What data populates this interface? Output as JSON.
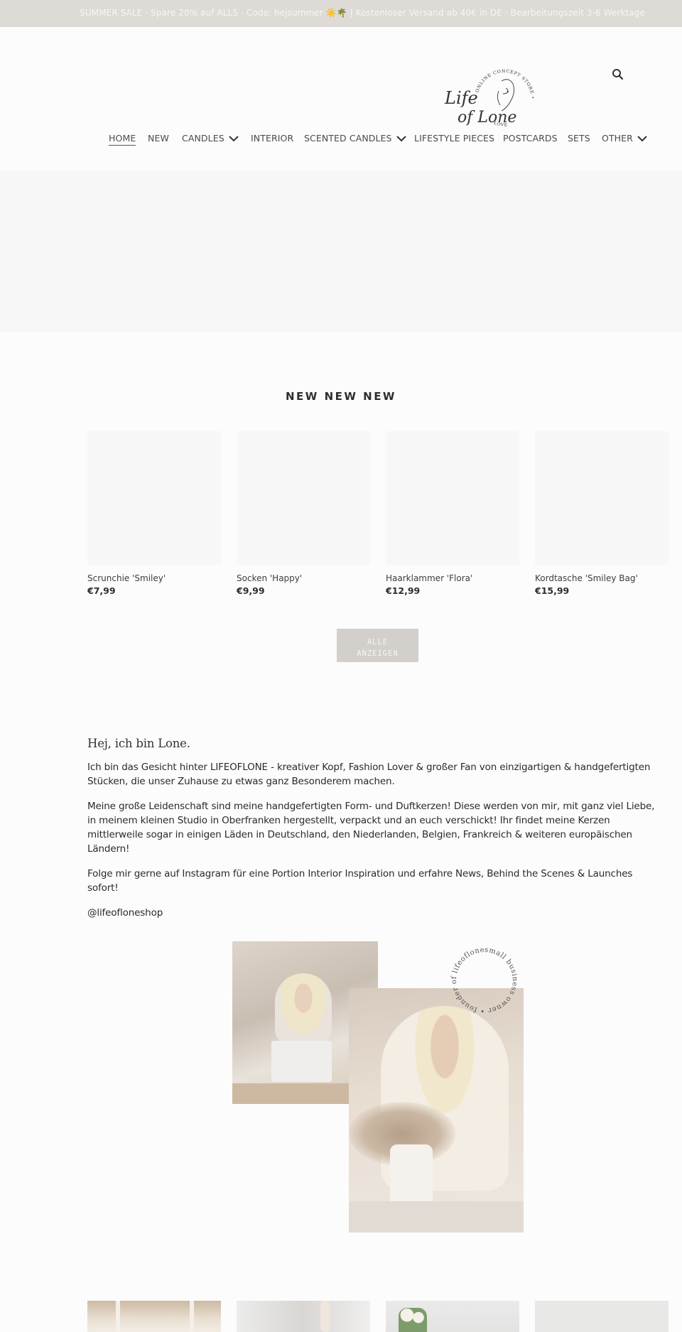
{
  "announcement": {
    "text": "SUMMER SALE · Spare 20% auf ALLS · Code: hejsummer ☀️🌴 | Kostenloser Versand ab 40€ in DE · Bearbeitungszeit 3-6 Werktage"
  },
  "header": {
    "logo": {
      "script_text": "Life of Lone",
      "ring_text": "ONLINE CONCEPT STORE • MADE WITH LOVE"
    },
    "search_icon": "search-icon"
  },
  "nav": {
    "items": [
      {
        "label": "HOME",
        "active": true,
        "dropdown": false
      },
      {
        "label": "NEW",
        "active": false,
        "dropdown": false
      },
      {
        "label": "CANDLES",
        "active": false,
        "dropdown": true
      },
      {
        "label": "INTERIOR",
        "active": false,
        "dropdown": false
      },
      {
        "label": "SCENTED CANDLES",
        "active": false,
        "dropdown": true
      },
      {
        "label": "LIFESTYLE PIECES",
        "active": false,
        "dropdown": false
      },
      {
        "label": "POSTCARDS",
        "active": false,
        "dropdown": false
      },
      {
        "label": "SETS",
        "active": false,
        "dropdown": false
      },
      {
        "label": "OTHER",
        "active": false,
        "dropdown": true
      }
    ]
  },
  "featured": {
    "title": "NEW NEW NEW",
    "products": [
      {
        "name": "Scrunchie 'Smiley'",
        "price": "€7,99"
      },
      {
        "name": "Socken 'Happy'",
        "price": "€9,99"
      },
      {
        "name": "Haarklammer 'Flora'",
        "price": "€12,99"
      },
      {
        "name": "Kordtasche 'Smiley Bag'",
        "price": "€15,99"
      }
    ],
    "view_all_line1": "ALLE",
    "view_all_line2": "ANZEIGEN"
  },
  "about": {
    "heading": "Hej, ich bin Lone.",
    "paragraphs": [
      "Ich bin das Gesicht hinter LIFEOFLONE - kreativer Kopf, Fashion Lover & großer Fan von einzigartigen & handgefertigten Stücken, die unser Zuhause zu etwas ganz Besonderem machen.",
      "Meine große Leidenschaft sind meine handgefertigten Form- und Duftkerzen! Diese werden von mir, mit ganz viel Liebe, in meinem kleinen Studio in Oberfranken hergestellt, verpackt und an euch verschickt! Ihr findet meine Kerzen mittlerweile sogar in einigen Läden in Deutschland, den Niederlanden, Belgien, Frankreich & weiteren europäischen Ländern!",
      "Folge mir gerne auf Instagram für eine Portion Interior Inspiration und erfahre News, Behind the Scenes & Launches sofort!",
      "@lifeofloneshop"
    ],
    "collage_badge_text": "small business owner • founder of lifeoflone •"
  },
  "colors": {
    "announcement_bg": "#dedbd6",
    "button_bg": "#d3cfca",
    "placeholder_bg": "#f7f7f7",
    "page_bg": "#fcfcfc"
  }
}
